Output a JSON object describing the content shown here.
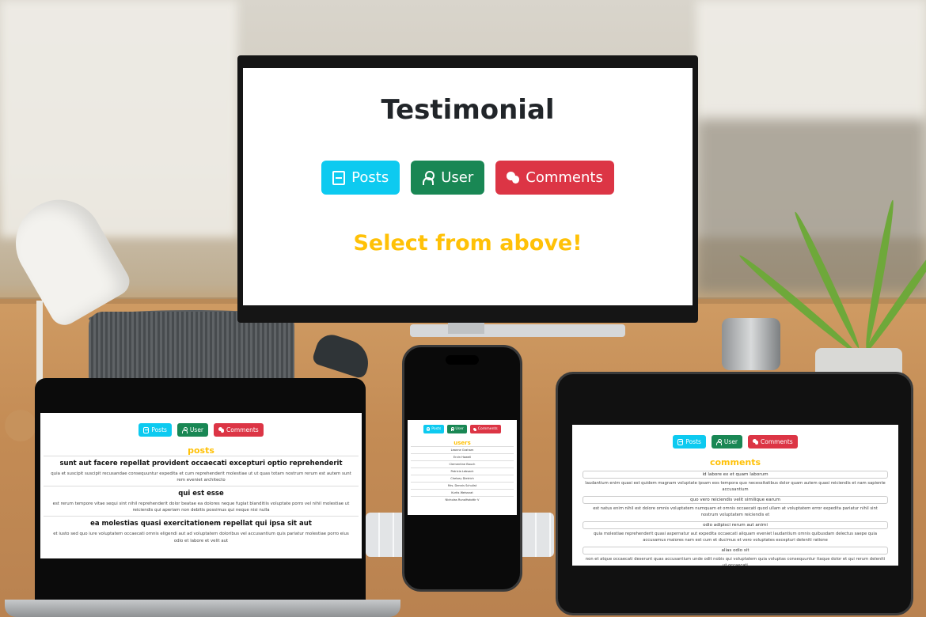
{
  "app": {
    "title": "Testimonial",
    "buttons": {
      "posts": "Posts",
      "user": "User",
      "comments": "Comments"
    },
    "prompt": "Select from above!",
    "colors": {
      "info": "#0dcaf0",
      "success": "#198754",
      "danger": "#dc3545",
      "accent": "#ffc107"
    }
  },
  "laptop": {
    "section_title": "posts",
    "posts": [
      {
        "title": "sunt aut facere repellat provident occaecati excepturi optio reprehenderit",
        "body": "quia et suscipit suscipit recusandae consequuntur expedita et cum reprehenderit molestiae ut ut quas totam nostrum rerum est autem sunt rem eveniet architecto"
      },
      {
        "title": "qui est esse",
        "body": "est rerum tempore vitae sequi sint nihil reprehenderit dolor beatae ea dolores neque fugiat blanditiis voluptate porro vel nihil molestiae ut reiciendis qui aperiam non debitis possimus qui neque nisi nulla"
      },
      {
        "title": "ea molestias quasi exercitationem repellat qui ipsa sit aut",
        "body": "et iusto sed quo iure voluptatem occaecati omnis eligendi aut ad voluptatem doloribus vel accusantium quis pariatur molestiae porro eius odio et labore et velit aut"
      }
    ]
  },
  "phone": {
    "section_title": "users",
    "users": [
      "Leanne Graham",
      "Ervin Howell",
      "Clementine Bauch",
      "Patricia Lebsack",
      "Chelsey Dietrich",
      "Mrs. Dennis Schulist",
      "Kurtis Weissnat",
      "Nicholas Runolfsdottir V"
    ]
  },
  "tablet": {
    "section_title": "comments",
    "comments": [
      {
        "name": "id labore ex et quam laborum",
        "body": "laudantium enim quasi est quidem magnam voluptate ipsam eos tempora quo necessitatibus dolor quam autem quasi reiciendis et nam sapiente accusantium"
      },
      {
        "name": "quo vero reiciendis velit similique earum",
        "body": "est natus enim nihil est dolore omnis voluptatem numquam et omnis occaecati quod ullam at voluptatem error expedita pariatur nihil sint nostrum voluptatem reiciendis et"
      },
      {
        "name": "odio adipisci rerum aut animi",
        "body": "quia molestiae reprehenderit quasi aspernatur aut expedita occaecati aliquam eveniet laudantium omnis quibusdam delectus saepe quia accusamus maiores nam est cum et ducimus et vero voluptates excepturi deleniti ratione"
      },
      {
        "name": "alias odio sit",
        "body": "non et atque occaecati deserunt quas accusantium unde odit nobis qui voluptatem quia voluptas consequuntur itaque dolor et qui rerum deleniti ut occaecati"
      }
    ]
  }
}
